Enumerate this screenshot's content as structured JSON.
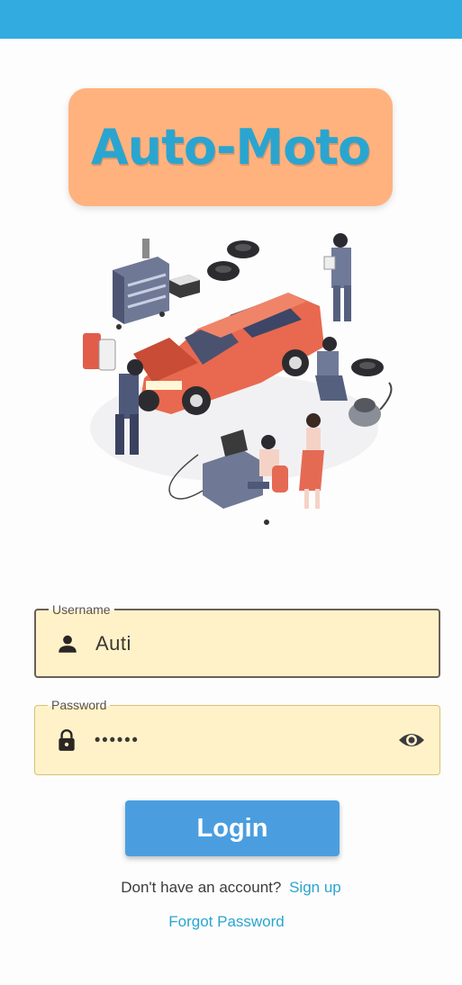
{
  "app": {
    "logo_text": "Auto-Moto"
  },
  "colors": {
    "status_bar": "#32abe0",
    "logo_bg": "#ffb27e",
    "logo_text": "#2aa5d0",
    "field_bg": "#fff2c9",
    "button": "#4a9ee0",
    "link": "#2aa5d0"
  },
  "illustration": {
    "subject": "mechanics repairing red car in garage"
  },
  "username": {
    "label": "Username",
    "value": "Auti",
    "icon": "person-icon"
  },
  "password": {
    "label": "Password",
    "value": "••••••",
    "icon": "lock-icon",
    "toggle_icon": "eye-icon"
  },
  "login": {
    "label": "Login"
  },
  "signup": {
    "prompt": "Don't have an account?",
    "link": "Sign up"
  },
  "forgot": {
    "label": "Forgot Password"
  }
}
